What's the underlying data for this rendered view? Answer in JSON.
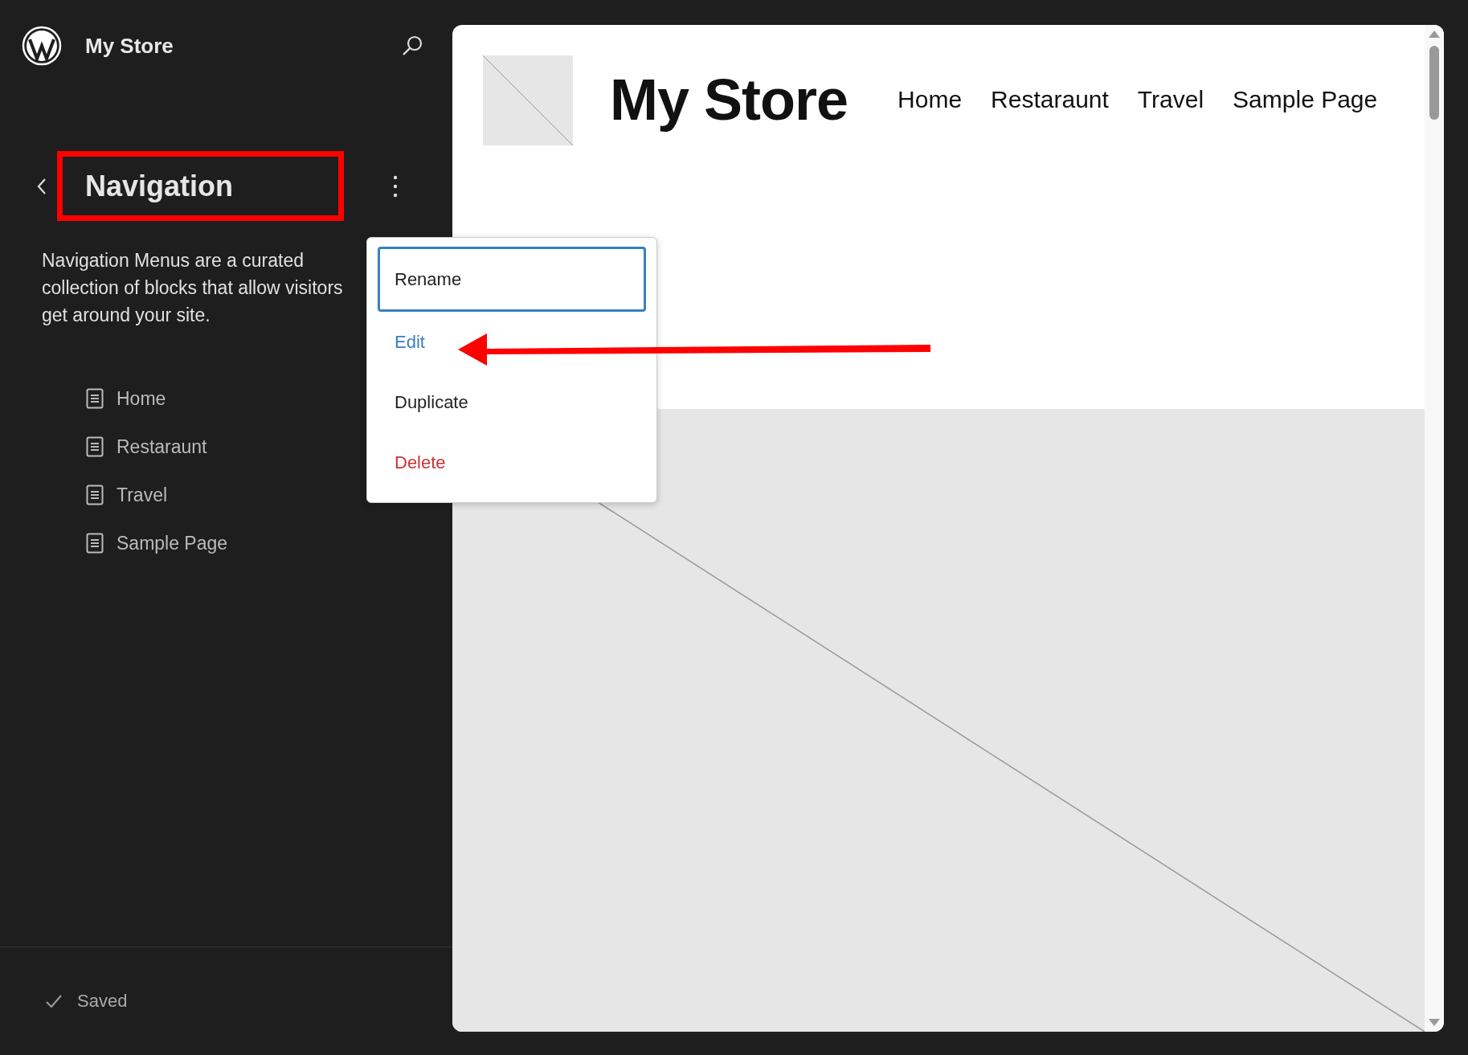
{
  "site": {
    "title": "My Store"
  },
  "panel": {
    "title": "Navigation",
    "description": [
      "Navigation Menus are a curated",
      "collection of blocks that allow visitors",
      "get around your site."
    ]
  },
  "menu_items": [
    {
      "label": "Home"
    },
    {
      "label": "Restaraunt"
    },
    {
      "label": "Travel"
    },
    {
      "label": "Sample Page"
    }
  ],
  "status": "Saved",
  "preview": {
    "site_title": "My Store",
    "nav": [
      "Home",
      "Restaraunt",
      "Travel",
      "Sample Page"
    ]
  },
  "context_menu": [
    {
      "label": "Rename",
      "kind": "normal",
      "focused": true
    },
    {
      "label": "Edit",
      "kind": "link",
      "focused": false
    },
    {
      "label": "Duplicate",
      "kind": "normal",
      "focused": false
    },
    {
      "label": "Delete",
      "kind": "danger",
      "focused": false
    }
  ]
}
